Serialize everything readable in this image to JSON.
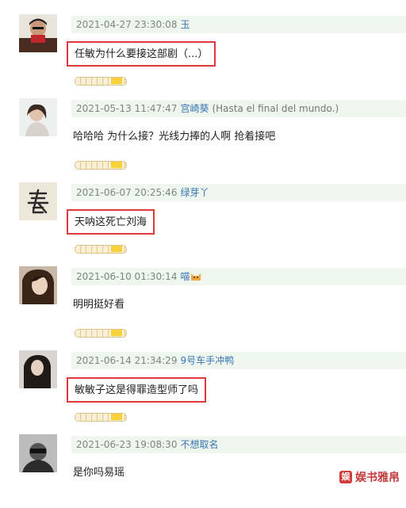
{
  "comments": [
    {
      "time": "2021-04-27 23:30:08",
      "user": "玉",
      "extra": "",
      "text": "任敏为什么要接这部剧（...）",
      "highlighted": true,
      "avatar": "person-portrait"
    },
    {
      "time": "2021-05-13 11:47:47",
      "user": "宫崎葵",
      "extra": "(Hasta el final del mundo.)",
      "text": "哈哈哈 为什么接？光线力捧的人啊 抢着接吧",
      "highlighted": false,
      "avatar": "woman-portrait"
    },
    {
      "time": "2021-06-07 20:25:46",
      "user": "绿芽丫",
      "extra": "",
      "text": "天呐这死亡刘海",
      "highlighted": true,
      "avatar": "calligraphy-chun"
    },
    {
      "time": "2021-06-10 01:30:14",
      "user": "喵",
      "extra": "",
      "text": "明明挺好看",
      "highlighted": false,
      "avatar": "girl-portrait",
      "emoji": "cat-emoji"
    },
    {
      "time": "2021-06-14 21:34:29",
      "user": "9号车手冲鸭",
      "extra": "",
      "text": "敏敏子这是得罪造型师了吗",
      "highlighted": true,
      "avatar": "woman-dark-portrait"
    },
    {
      "time": "2021-06-23 19:08:30",
      "user": "不想取名",
      "extra": "",
      "text": "是你吗易瑶",
      "highlighted": false,
      "avatar": "person-bw-portrait"
    }
  ],
  "watermark": {
    "text": "娱书雅帛",
    "icon": "brand-logo-icon"
  },
  "colors": {
    "meta_bg": "#eef6ee",
    "user": "#3a76b8",
    "highlight_border": "#e0393e",
    "watermark": "#c43a3a"
  }
}
